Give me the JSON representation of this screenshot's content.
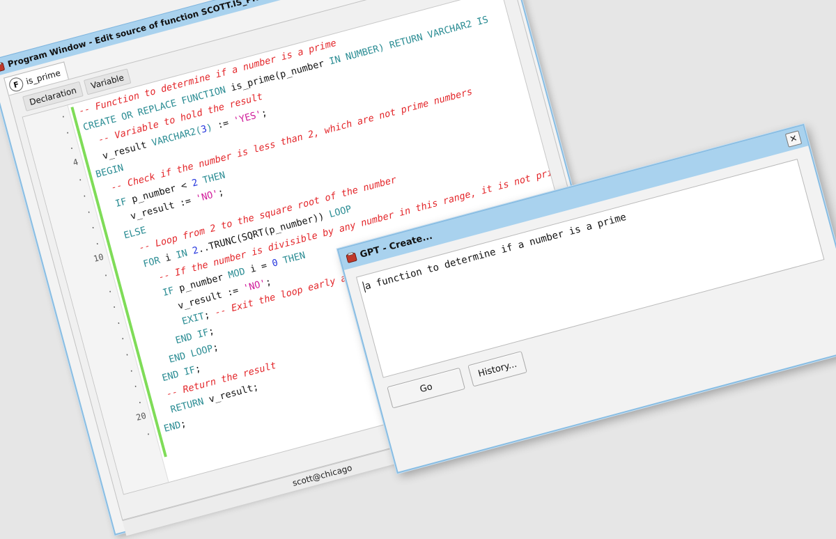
{
  "program_window": {
    "title": "Program Window - Edit source of function SCOTT.IS_PRIME@CHICAGO",
    "scroll_arrows": "< >",
    "tab": {
      "icon_letter": "F",
      "label": "is_prime"
    },
    "subtabs": [
      "Declaration",
      "Variable"
    ],
    "gutter": [
      ".",
      ".",
      ".",
      "4",
      ".",
      ".",
      ".",
      ".",
      ".",
      "10",
      ".",
      ".",
      ".",
      ".",
      ".",
      ".",
      ".",
      ".",
      ".",
      "20",
      "."
    ],
    "code_lines": [
      [
        {
          "t": "comment",
          "s": "-- Function to determine if a number is a prime"
        }
      ],
      [
        {
          "t": "kw",
          "s": "CREATE OR REPLACE FUNCTION "
        },
        {
          "t": "plain",
          "s": "is_prime(p_number "
        },
        {
          "t": "kw",
          "s": "IN NUMBER) RETURN VARCHAR2 IS"
        }
      ],
      [
        {
          "t": "plain",
          "s": "  "
        },
        {
          "t": "comment",
          "s": "-- Variable to hold the result"
        }
      ],
      [
        {
          "t": "plain",
          "s": "  v_result "
        },
        {
          "t": "kw",
          "s": "VARCHAR2("
        },
        {
          "t": "num",
          "s": "3"
        },
        {
          "t": "kw",
          "s": ")"
        },
        {
          "t": "plain",
          "s": " := "
        },
        {
          "t": "str",
          "s": "'YES'"
        },
        {
          "t": "plain",
          "s": ";"
        }
      ],
      [
        {
          "t": "kw",
          "s": "BEGIN"
        }
      ],
      [
        {
          "t": "plain",
          "s": "  "
        },
        {
          "t": "comment",
          "s": "-- Check if the number is less than 2, which are not prime numbers"
        }
      ],
      [
        {
          "t": "plain",
          "s": "  "
        },
        {
          "t": "kw",
          "s": "IF "
        },
        {
          "t": "plain",
          "s": "p_number < "
        },
        {
          "t": "num",
          "s": "2"
        },
        {
          "t": "kw",
          "s": " THEN"
        }
      ],
      [
        {
          "t": "plain",
          "s": "    v_result := "
        },
        {
          "t": "str",
          "s": "'NO'"
        },
        {
          "t": "plain",
          "s": ";"
        }
      ],
      [
        {
          "t": "plain",
          "s": "  "
        },
        {
          "t": "kw",
          "s": "ELSE"
        }
      ],
      [
        {
          "t": "plain",
          "s": "    "
        },
        {
          "t": "comment",
          "s": "-- Loop from 2 to the square root of the number"
        }
      ],
      [
        {
          "t": "plain",
          "s": "    "
        },
        {
          "t": "kw",
          "s": "FOR "
        },
        {
          "t": "plain",
          "s": "i "
        },
        {
          "t": "kw",
          "s": "IN "
        },
        {
          "t": "num",
          "s": "2"
        },
        {
          "t": "plain",
          "s": "..TRUNC(SQRT(p_number)) "
        },
        {
          "t": "kw",
          "s": "LOOP"
        }
      ],
      [
        {
          "t": "plain",
          "s": "      "
        },
        {
          "t": "comment",
          "s": "-- If the number is divisible by any number in this range, it is not prime"
        }
      ],
      [
        {
          "t": "plain",
          "s": "      "
        },
        {
          "t": "kw",
          "s": "IF "
        },
        {
          "t": "plain",
          "s": "p_number "
        },
        {
          "t": "kw",
          "s": "MOD "
        },
        {
          "t": "plain",
          "s": "i = "
        },
        {
          "t": "num",
          "s": "0"
        },
        {
          "t": "kw",
          "s": " THEN"
        }
      ],
      [
        {
          "t": "plain",
          "s": "        v_result := "
        },
        {
          "t": "str",
          "s": "'NO'"
        },
        {
          "t": "plain",
          "s": ";"
        }
      ],
      [
        {
          "t": "plain",
          "s": "        "
        },
        {
          "t": "kw",
          "s": "EXIT"
        },
        {
          "t": "plain",
          "s": "; "
        },
        {
          "t": "comment",
          "s": "-- Exit the loop early as we found a divisor"
        }
      ],
      [
        {
          "t": "plain",
          "s": "      "
        },
        {
          "t": "kw",
          "s": "END IF"
        },
        {
          "t": "plain",
          "s": ";"
        }
      ],
      [
        {
          "t": "plain",
          "s": "    "
        },
        {
          "t": "kw",
          "s": "END LOOP"
        },
        {
          "t": "plain",
          "s": ";"
        }
      ],
      [
        {
          "t": "plain",
          "s": "  "
        },
        {
          "t": "kw",
          "s": "END IF"
        },
        {
          "t": "plain",
          "s": ";"
        }
      ],
      [
        {
          "t": "plain",
          "s": "  "
        },
        {
          "t": "comment",
          "s": "-- Return the result"
        }
      ],
      [
        {
          "t": "plain",
          "s": "  "
        },
        {
          "t": "kw",
          "s": "RETURN "
        },
        {
          "t": "plain",
          "s": "v_result;"
        }
      ],
      [
        {
          "t": "kw",
          "s": "END"
        },
        {
          "t": "plain",
          "s": ";"
        }
      ]
    ],
    "status_text": "scott@chicago"
  },
  "gpt_dialog": {
    "title": "GPT - Create...",
    "close_glyph": "✕",
    "prompt_text": "a function to determine if a number is a prime",
    "go_label": "Go",
    "history_label": "History..."
  },
  "colors": {
    "titlebar": "#a9d2ee",
    "border": "#88bde3",
    "comment": "#e3262a",
    "keyword": "#2a8c93",
    "string": "#d01c9a",
    "number": "#2233dd",
    "modified_bar": "#7fdc58"
  },
  "icons": {
    "app": "app-icon",
    "function_tab": "function-icon",
    "pin": "pin-icon",
    "close": "close-icon"
  }
}
